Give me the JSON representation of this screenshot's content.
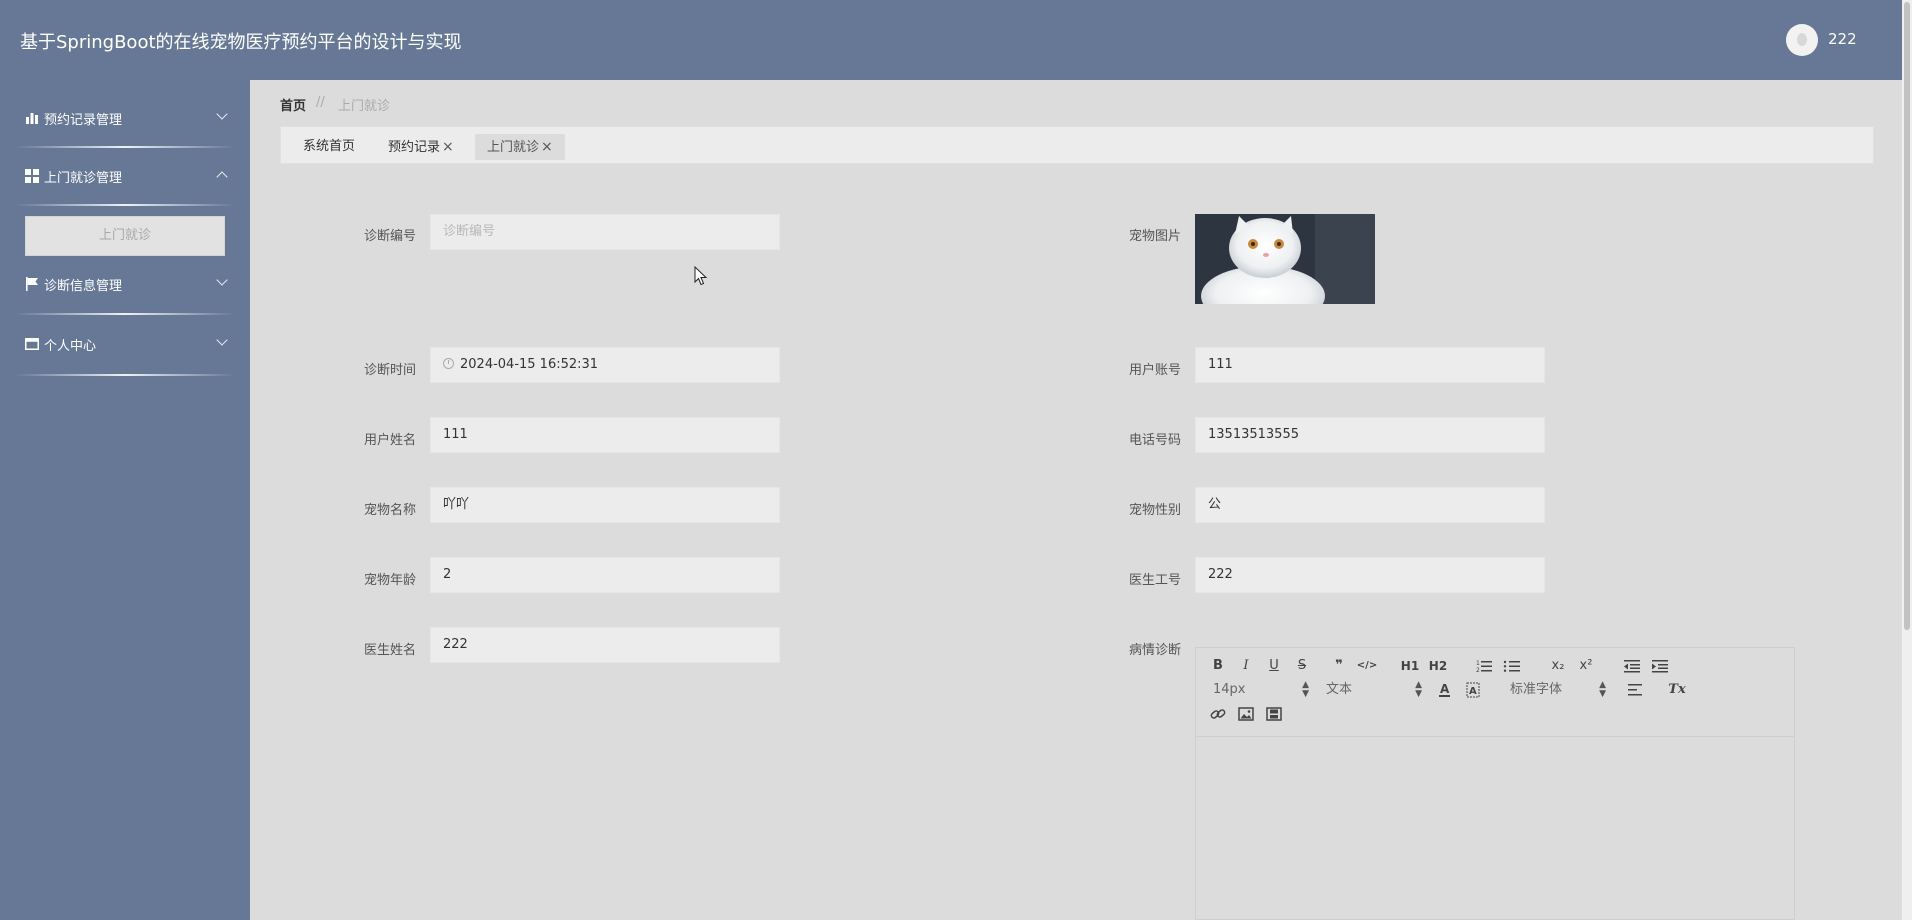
{
  "header": {
    "app_title": "基于SpringBoot的在线宠物医疗预约平台的设计与实现",
    "username": "222"
  },
  "sidebar": {
    "menus": [
      {
        "label": "预约记录管理",
        "icon": "bar-chart-icon",
        "expanded": false
      },
      {
        "label": "上门就诊管理",
        "icon": "grid-icon",
        "expanded": true,
        "children": [
          "上门就诊"
        ]
      },
      {
        "label": "诊断信息管理",
        "icon": "flag-icon",
        "expanded": false
      },
      {
        "label": "个人中心",
        "icon": "window-icon",
        "expanded": false
      }
    ]
  },
  "breadcrumb": {
    "home": "首页",
    "separator": "//",
    "current": "上门就诊"
  },
  "tabs": [
    {
      "label": "系统首页",
      "closable": false,
      "active": false
    },
    {
      "label": "预约记录",
      "closable": true,
      "active": false
    },
    {
      "label": "上门就诊",
      "closable": true,
      "active": true
    }
  ],
  "tab_close_symbol": "×",
  "form": {
    "diagnosis_no": {
      "label": "诊断编号",
      "value": "",
      "placeholder": "诊断编号"
    },
    "pet_image": {
      "label": "宠物图片"
    },
    "diagnosis_time": {
      "label": "诊断时间",
      "value": "2024-04-15 16:52:31"
    },
    "user_account": {
      "label": "用户账号",
      "value": "111"
    },
    "user_name": {
      "label": "用户姓名",
      "value": "111"
    },
    "phone": {
      "label": "电话号码",
      "value": "13513513555"
    },
    "pet_name": {
      "label": "宠物名称",
      "value": "吖吖"
    },
    "pet_gender": {
      "label": "宠物性别",
      "value": "公"
    },
    "pet_age": {
      "label": "宠物年龄",
      "value": "2"
    },
    "doctor_id": {
      "label": "医生工号",
      "value": "222"
    },
    "doctor_name": {
      "label": "医生姓名",
      "value": "222"
    },
    "condition_diagnosis": {
      "label": "病情诊断",
      "value": ""
    }
  },
  "editor_toolbar": {
    "bold": "B",
    "italic": "I",
    "underline": "U",
    "strike": "S",
    "blockquote": "❞",
    "code": "</>",
    "h1": "H1",
    "h2": "H2",
    "subscript": "x₂",
    "superscript": "x²",
    "font_size": "14px",
    "header_select": "文本",
    "font_family": "标准字体",
    "clear": "Tx"
  },
  "colors": {
    "header_bg": "#667895",
    "sidebar_bg": "#667895",
    "page_bg": "#dcdcdc",
    "field_bg": "#ececec"
  }
}
